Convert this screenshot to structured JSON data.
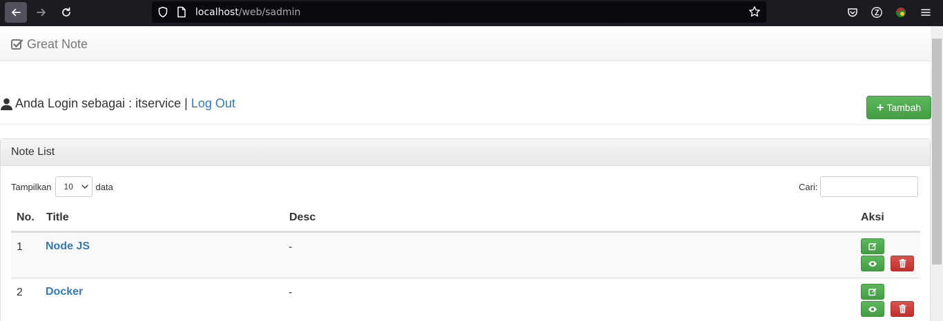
{
  "browser": {
    "url_host": "localhost",
    "url_path": "/web/sadmin"
  },
  "app": {
    "brand": "Great Note"
  },
  "header": {
    "login_text": "Anda Login sebagai : itservice |",
    "logout_label": "Log Out",
    "add_button_label": "Tambah"
  },
  "panel": {
    "title": "Note List",
    "length_prefix": "Tampilkan",
    "length_value": "10",
    "length_suffix": "data",
    "search_label": "Cari:",
    "search_value": ""
  },
  "table": {
    "columns": [
      "No.",
      "Title",
      "Desc",
      "Aksi"
    ],
    "rows": [
      {
        "no": "1",
        "title": "Node JS",
        "desc": "-"
      },
      {
        "no": "2",
        "title": "Docker",
        "desc": "-"
      }
    ]
  },
  "colors": {
    "success": "#5cb85c",
    "danger": "#d9534f",
    "link": "#337ab7",
    "browser_bg": "#1c1b22"
  }
}
